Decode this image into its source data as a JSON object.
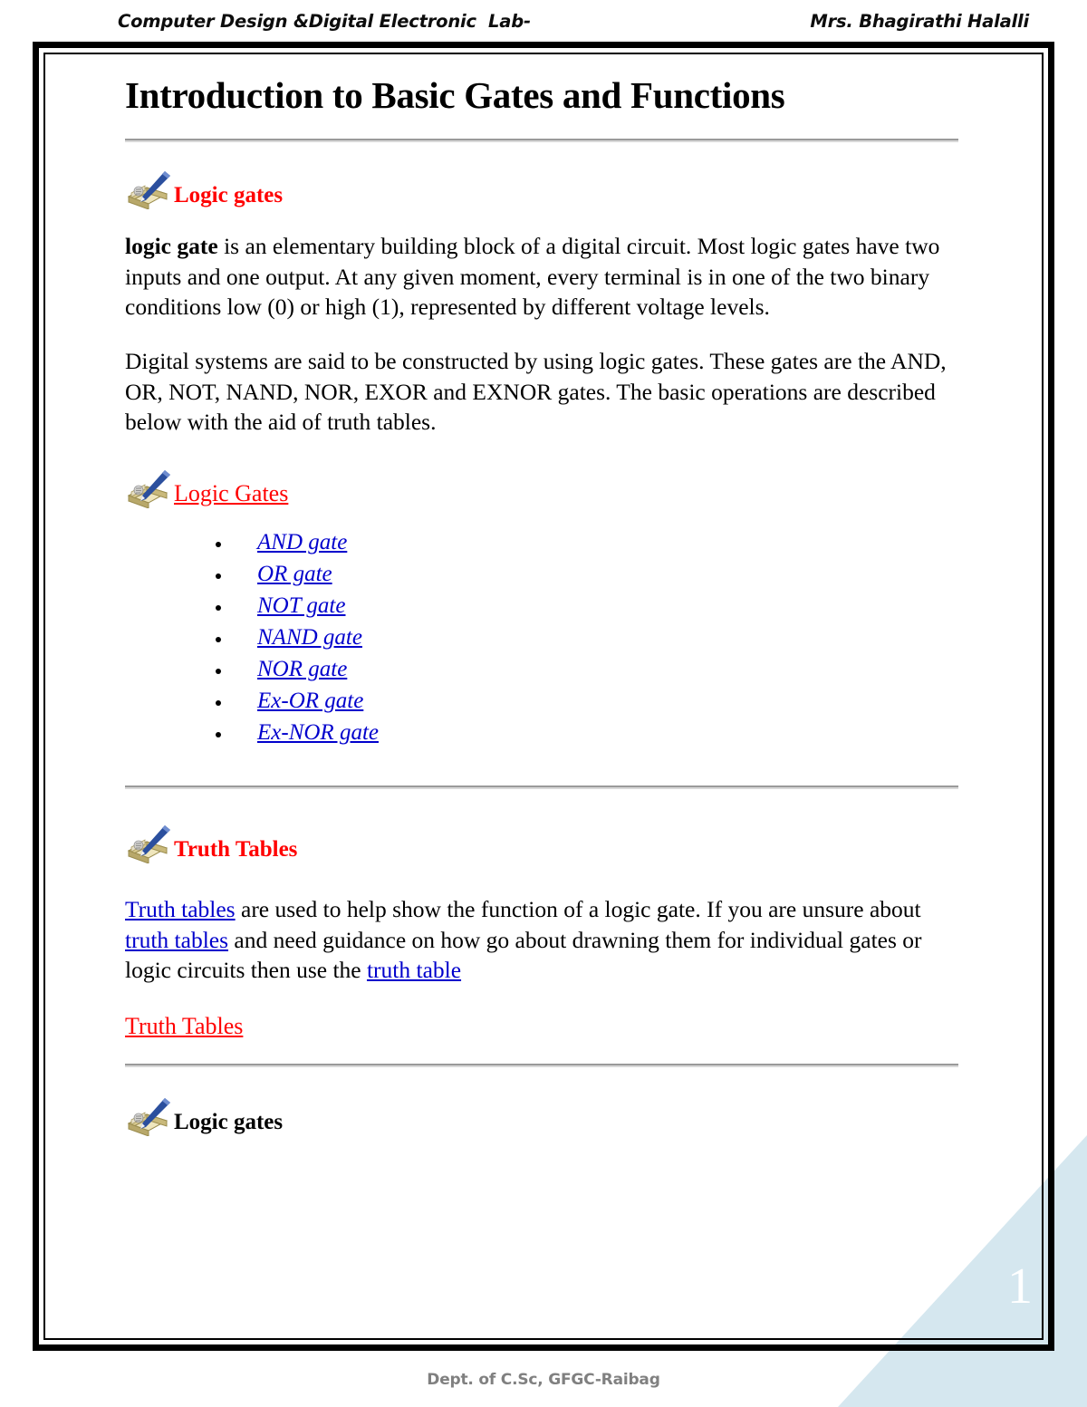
{
  "header": {
    "left": "Computer Design &Digital Electronic  Lab-",
    "right": "Mrs. Bhagirathi Halalli"
  },
  "title": "Introduction to Basic Gates and Functions",
  "sections": {
    "logic_gates_heading": "Logic gates",
    "paragraph_1": {
      "bold_lead": "logic gate",
      "rest": " is an elementary building block of a digital circuit. Most logic gates have two inputs and one output. At any given moment, every terminal is in one of the two binary conditions low (0) or high (1), represented by different voltage levels."
    },
    "paragraph_2": "Digital systems are said to be constructed by using logic gates. These gates are the AND, OR, NOT, NAND, NOR, EXOR and EXNOR gates. The basic operations are described below with the aid of truth tables.",
    "logic_gates_link_heading": "Logic Gates",
    "gate_list": [
      "AND gate",
      "OR gate",
      "NOT gate",
      "NAND gate",
      "NOR gate",
      "Ex-OR gate",
      "Ex-NOR gate"
    ],
    "truth_tables_heading": "Truth Tables",
    "truth_tables_paragraph": {
      "link_1": "Truth tables",
      "text_1": " are used to help show the function of a logic gate. If you are unsure about ",
      "link_2": "truth tables",
      "text_2": " and need guidance on how go about drawning them for individual gates or logic circuits then use the ",
      "link_3": "truth table"
    },
    "truth_tables_link": "Truth Tables",
    "logic_gates_heading_2": "Logic gates"
  },
  "page_number": "1",
  "footer": "Dept. of C.Sc, GFGC-Raibag",
  "colors": {
    "heading_red": "#ff0000",
    "link_blue": "#0000cc",
    "corner_blue": "#d5e7ef",
    "rule_gray": "#9a9a9a",
    "footer_gray": "#808080"
  },
  "icons": {
    "book_pen": "book-pen-icon"
  }
}
